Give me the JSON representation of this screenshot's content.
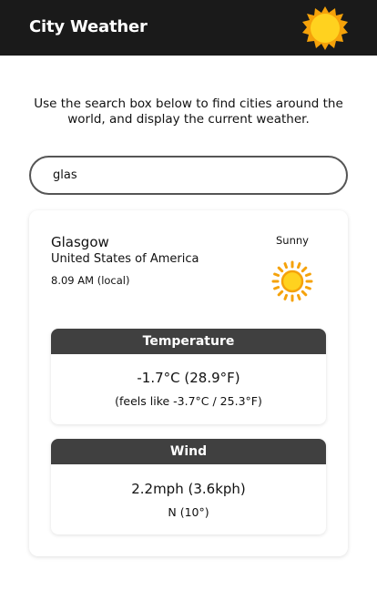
{
  "header": {
    "title": "City Weather",
    "logo_icon": "sun-logo-icon"
  },
  "intro": {
    "text": "Use the search box below to find cities around the world, and display the current weather."
  },
  "search": {
    "value": "glas",
    "placeholder": ""
  },
  "weather": {
    "city": "Glasgow",
    "country": "United States of America",
    "local_time": "8.09 AM (local)",
    "condition": "Sunny",
    "condition_icon": "sun-icon",
    "temperature": {
      "heading": "Temperature",
      "value": "-1.7°C (28.9°F)",
      "feels_like": "(feels like -3.7°C / 25.3°F)"
    },
    "wind": {
      "heading": "Wind",
      "speed": "2.2mph (3.6kph)",
      "direction": "N (10°)"
    }
  },
  "colors": {
    "header_bg": "#1a1a1a",
    "panel_header_bg": "#404040",
    "sun_yellow": "#ffd21f",
    "sun_orange": "#f5a20a"
  }
}
